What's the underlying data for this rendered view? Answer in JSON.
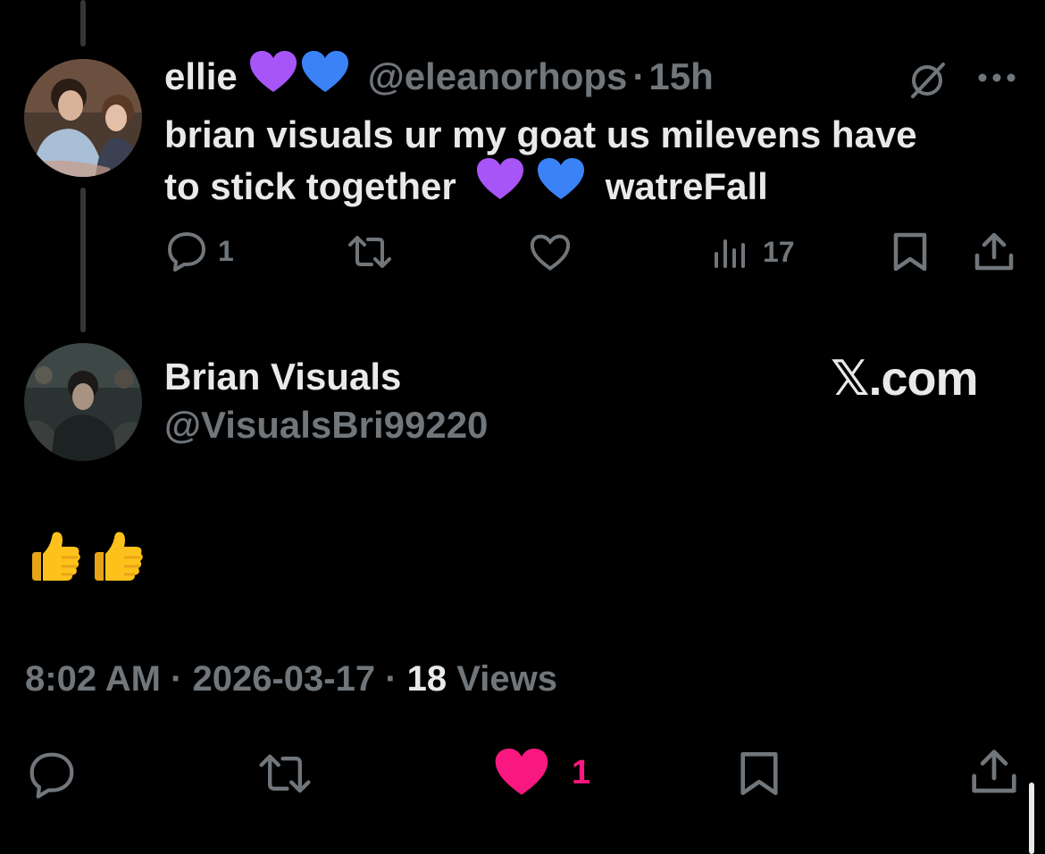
{
  "colors": {
    "background": "#000000",
    "text": "#e7e9ea",
    "muted": "#71767b",
    "like": "#f91880",
    "purple_heart": "#a855f7",
    "blue_heart": "#3b82f6"
  },
  "reply_tweet": {
    "display_name": "ellie",
    "handle": "@eleanorhops",
    "separator": "·",
    "time_ago": "15h",
    "text_line1": "brian visuals ur my goat us milevens have",
    "text_line2_start": "to stick together",
    "text_line2_end": "watreFall",
    "replies": "1",
    "views": "17",
    "icons": [
      "grok-icon",
      "more-icon",
      "reply-icon",
      "retweet-icon",
      "like-icon",
      "views-icon",
      "bookmark-icon",
      "share-icon"
    ]
  },
  "main_tweet": {
    "display_name": "Brian Visuals",
    "handle": "@VisualsBri99220",
    "watermark": "𝕏.com",
    "body": "👍👍",
    "time": "8:02 AM",
    "date": "2026-03-17",
    "view_count": "18",
    "views_label": "Views",
    "separator": "·",
    "likes": "1",
    "icons": [
      "reply-icon",
      "retweet-icon",
      "liked-heart-icon",
      "bookmark-icon",
      "share-icon"
    ]
  }
}
